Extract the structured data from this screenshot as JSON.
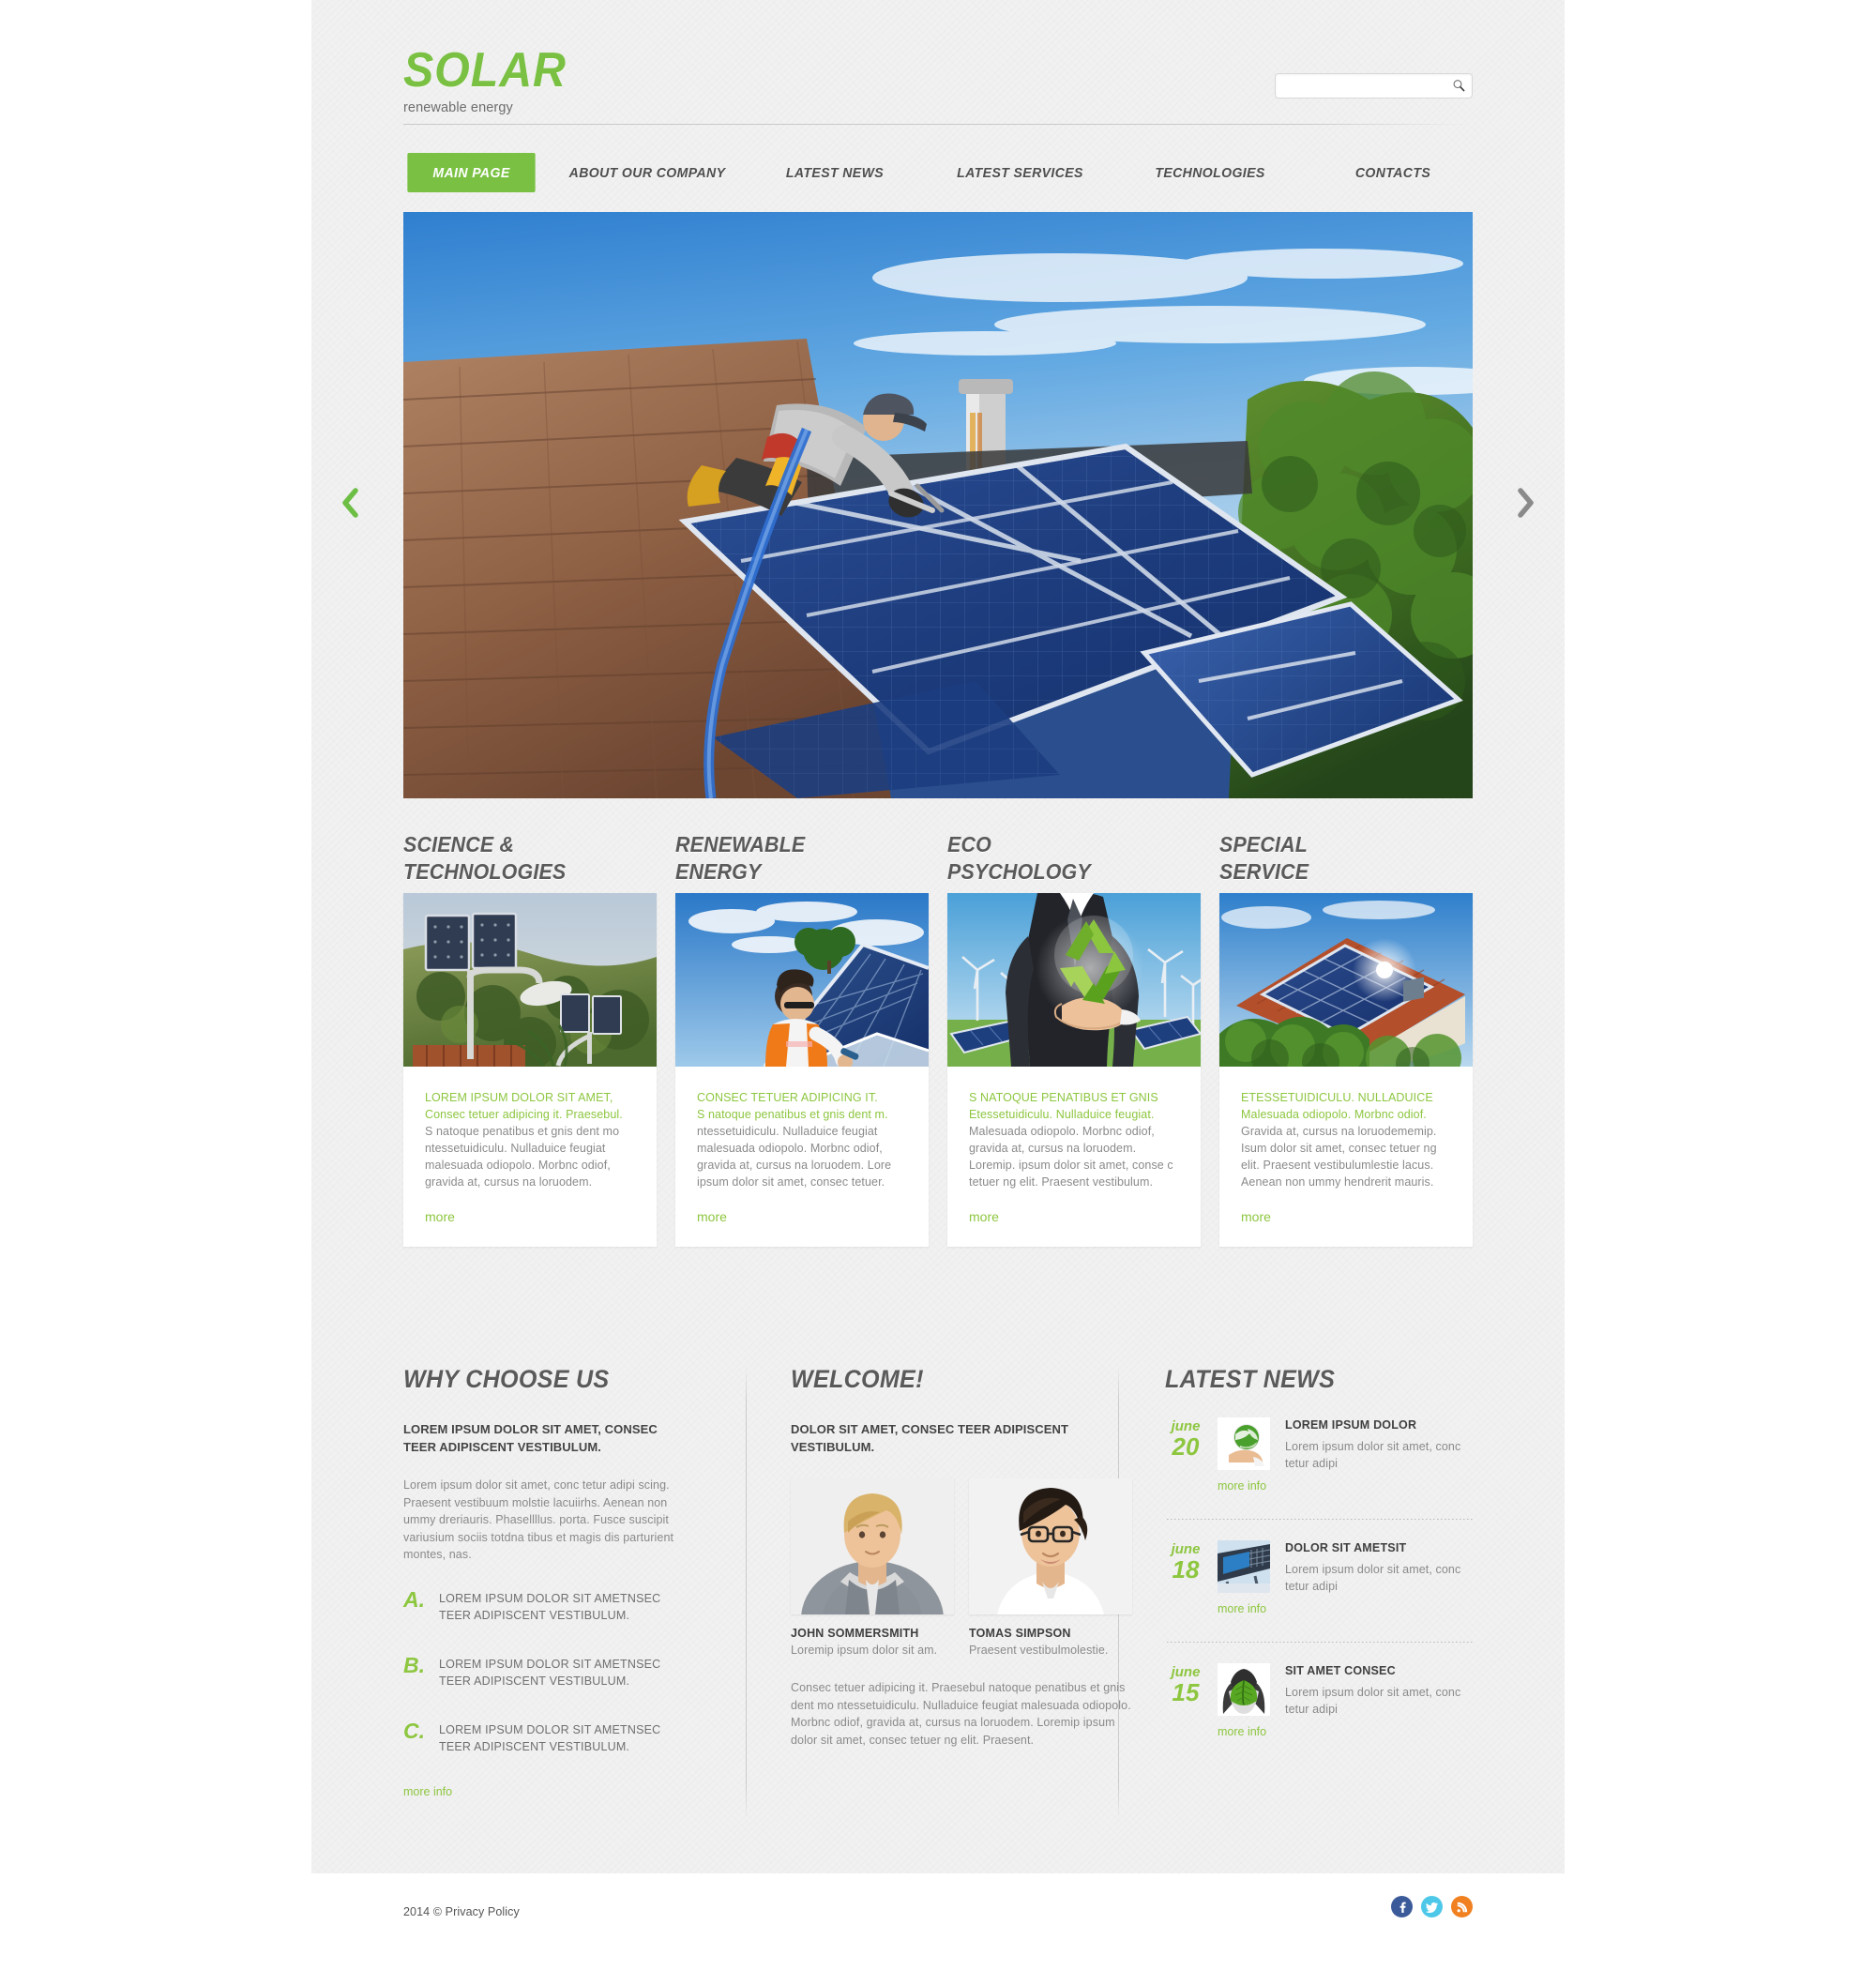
{
  "brand": {
    "logo": "SOLAR",
    "tagline": "renewable energy"
  },
  "search": {
    "value": "",
    "placeholder": "",
    "icon": "search-icon"
  },
  "nav": {
    "items": [
      {
        "label": "MAIN PAGE",
        "active": true
      },
      {
        "label": "ABOUT OUR COMPANY",
        "active": false
      },
      {
        "label": "LATEST NEWS",
        "active": false
      },
      {
        "label": "LATEST SERVICES",
        "active": false
      },
      {
        "label": "TECHNOLOGIES",
        "active": false
      },
      {
        "label": "CONTACTS",
        "active": false
      }
    ]
  },
  "slider": {
    "prev_icon": "chevron-left-icon",
    "next_icon": "chevron-right-icon",
    "caption": "Worker installing blue solar panels on a shingled house roof under a blue sky"
  },
  "features": [
    {
      "title": "SCIENCE &\nTECHNOLOGIES",
      "lead": "LOREM IPSUM DOLOR SIT AMET,\nConsec tetuer adipicing it. Praesebul.",
      "text": "S natoque penatibus et gnis dent mo ntessetuidiculu. Nulladuice feugiat malesuada odiopolo. Morbnc odiof, gravida at, cursus na loruodem.",
      "more": "more",
      "image_alt": "solar-panels-street-lamp-photo"
    },
    {
      "title": "RENEWABLE\nENERGY",
      "lead": "CONSEC TETUER ADIPICING IT.\nS natoque penatibus et gnis dent m.",
      "text": "ntessetuidiculu. Nulladuice feugiat malesuada odiopolo. Morbnc odiof, gravida at, cursus na loruodem. Lore ipsum dolor sit amet, consec tetuer.",
      "more": "more",
      "image_alt": "technician-installing-roof-panels-photo"
    },
    {
      "title": "ECO\nPSYCHOLOGY",
      "lead": "S NATOQUE PENATIBUS ET GNIS\nEtessetuidiculu. Nulladuice feugiat.",
      "text": "Malesuada odiopolo. Morbnc odiof, gravida at, cursus na loruodem. Loremip. ipsum dolor sit amet, conse c tetuer ng elit. Praesent vestibulum.",
      "more": "more",
      "image_alt": "businessman-holding-recycle-globe-photo"
    },
    {
      "title": "SPECIAL\nSERVICE",
      "lead": "ETESSETUIDICULU. NULLADUICE\nMalesuada odiopolo. Morbnc odiof.",
      "text": "Gravida at, cursus na loruodememip. Isum dolor sit amet, consec tetuer ng elit. Praesent vestibulumlestie lacus. Aenean non ummy hendrerit mauris.",
      "more": "more",
      "image_alt": "house-with-rooftop-solar-panels-photo"
    }
  ],
  "why_choose_us": {
    "title": "WHY CHOOSE US",
    "subtitle": "LOREM IPSUM DOLOR SIT AMET, CONSEC TEER ADIPISCENT VESTIBULUM.",
    "body": "Lorem ipsum dolor sit amet, conc tetur adipi scing. Praesent vestibuum molstie lacuiirhs. Aenean non ummy dreriauris. Phasellllus. porta. Fusce suscipit variusium sociis totdna tibus et magis dis parturient montes, nas.",
    "list": [
      {
        "letter": "A.",
        "text": "LOREM IPSUM DOLOR SIT AMETNSEC TEER ADIPISCENT VESTIBULUM."
      },
      {
        "letter": "B.",
        "text": "LOREM IPSUM DOLOR SIT AMETNSEC TEER ADIPISCENT VESTIBULUM."
      },
      {
        "letter": "C.",
        "text": "LOREM IPSUM DOLOR SIT AMETNSEC TEER ADIPISCENT VESTIBULUM."
      }
    ],
    "more": "more info"
  },
  "welcome": {
    "title": "WELCOME!",
    "subtitle": "DOLOR SIT AMET, CONSEC TEER ADIPISCENT VESTIBULUM.",
    "people": [
      {
        "name": "JOHN SOMMERSMITH",
        "desc": "Loremip ipsum dolor sit am.",
        "photo_alt": "portrait-blond-man-photo"
      },
      {
        "name": "TOMAS SIMPSON",
        "desc": "Praesent vestibulmolestie.",
        "photo_alt": "portrait-dark-haired-man-glasses-photo"
      }
    ],
    "body": "Consec tetuer adipicing it. Praesebul natoque penatibus et gnis dent mo ntessetuidiculu. Nulladuice feugiat  malesuada odiopolo. Morbnc odiof,  gravida at, cursus na loruodem. Loremip ipsum dolor sit amet, consec tetuer ng elit. Praesent."
  },
  "latest_news": {
    "title": "LATEST NEWS",
    "items": [
      {
        "month": "june",
        "day": "20",
        "title": "LOREM IPSUM DOLOR",
        "text": "Lorem ipsum dolor sit amet, conc tetur adipi",
        "more": "more info",
        "thumb_alt": "hand-holding-green-globe-icon"
      },
      {
        "month": "june",
        "day": "18",
        "title": "DOLOR SIT AMETSIT",
        "text": "Lorem ipsum dolor sit amet, conc tetur adipi",
        "more": "more info",
        "thumb_alt": "solar-panel-array-underside-photo"
      },
      {
        "month": "june",
        "day": "15",
        "title": "SIT AMET CONSEC",
        "text": "Lorem ipsum dolor sit amet, conc tetur adipi",
        "more": "more info",
        "thumb_alt": "gloved-hands-holding-green-leaf-photo"
      }
    ]
  },
  "footer": {
    "copyright": "2014 © Privacy Policy",
    "socials": [
      {
        "name": "facebook",
        "glyph": "f",
        "color": "#3b5a9a"
      },
      {
        "name": "twitter",
        "glyph": "t",
        "color": "#4ec8e8"
      },
      {
        "name": "rss",
        "glyph": "r",
        "color": "#f08020"
      }
    ]
  },
  "colors": {
    "accent_green": "#7ac143",
    "text_green": "#8dc63f",
    "heading_gray": "#5a5a5a",
    "body_gray": "#8a8a8a",
    "page_bg": "#f1f1f1"
  }
}
